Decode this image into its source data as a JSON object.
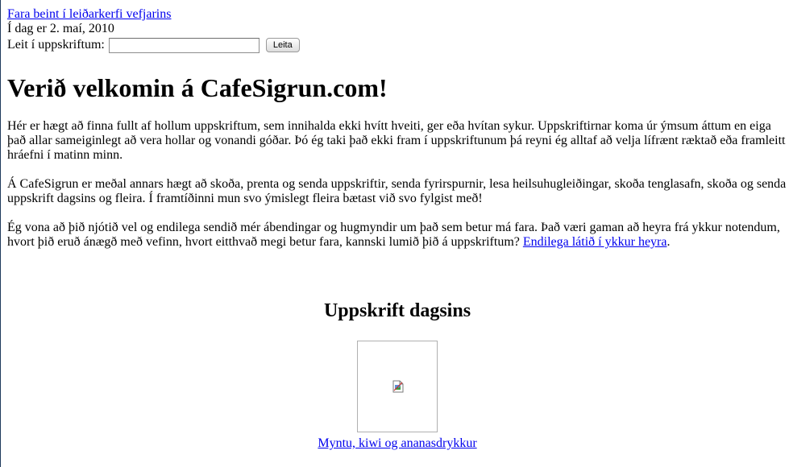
{
  "skip_link": "Fara beint í leiðarkerfi vefjarins",
  "date_text": "Í dag er 2. maí, 2010",
  "search": {
    "label": "Leit í uppskriftum:",
    "value": "",
    "button_label": "Leita"
  },
  "heading": "Verið velkomin á CafeSigrun.com!",
  "paragraphs": {
    "p1": "Hér er hægt að finna fullt af hollum uppskriftum, sem innihalda ekki hvítt hveiti, ger eða hvítan sykur. Uppskriftirnar koma úr ýmsum áttum en eiga það allar sameiginlegt að vera hollar og vonandi góðar. Þó ég taki það ekki fram í uppskriftunum þá reyni ég alltaf að velja lífrænt ræktað eða framleitt hráefni í matinn minn.",
    "p2": "Á CafeSigrun er meðal annars hægt að skoða, prenta og senda uppskriftir, senda fyrirspurnir, lesa heilsuhugleiðingar, skoða tenglasafn, skoða og senda uppskrift dagsins og fleira. Í framtíðinni mun svo ýmislegt fleira bætast við svo fylgist með!",
    "p3_text": "Ég vona að þið njótið vel og endilega sendið mér ábendingar og hugmyndir um það sem betur má fara. Það væri gaman að heyra frá ykkur notendum, hvort þið eruð ánægð með vefinn, hvort eitthvað megi betur fara, kannski lumið þið á uppskriftum? ",
    "p3_link": "Endilega látið í ykkur heyra",
    "p3_end": "."
  },
  "feature": {
    "title": "Uppskrift dagsins",
    "image_icon": "broken-image-icon",
    "recipe_link": "Myntu, kiwi og ananasdrykkur"
  },
  "colors": {
    "link": "#0000ee",
    "text": "#000000",
    "background": "#ffffff"
  }
}
